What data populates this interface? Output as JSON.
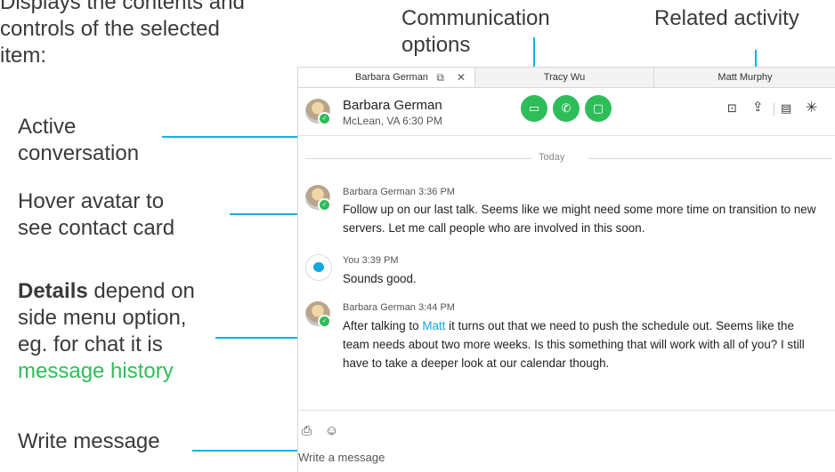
{
  "annotations": {
    "intro_line1": "Displays the contents and",
    "intro_line2": "controls of the selected",
    "intro_line3": "item:",
    "active_line1": "Active",
    "active_line2": "conversation",
    "hover_line1": "Hover avatar to",
    "hover_line2": "see contact card",
    "details_bold": "Details",
    "details_line1_rest": " depend on",
    "details_line2": "side menu option,",
    "details_line3": "eg. for chat it is",
    "details_line4": "message history",
    "write": "Write message",
    "comm_line1": "Communication",
    "comm_line2": "options",
    "related": "Related activity"
  },
  "tabs": [
    {
      "label": "Barbara German"
    },
    {
      "label": "Tracy Wu"
    },
    {
      "label": "Matt Murphy"
    }
  ],
  "header": {
    "name": "Barbara German",
    "location": "McLean, VA 6:30 PM"
  },
  "divider_label": "Today",
  "messages": [
    {
      "meta": "Barbara German  3:36 PM",
      "line1": "Follow up on our last talk. Seems like we might need some more time on transition to new",
      "line2": "servers. Let me call people who are involved in this soon."
    },
    {
      "meta": "You  3:39 PM",
      "line1": "Sounds good."
    },
    {
      "meta": "Barbara German  3:44 PM",
      "pre": "After talking to ",
      "link": "Matt",
      "post": " it turns out that we need to push the schedule out. Seems like the",
      "line2": "team needs about two more weeks. Is this something that will work with all of you? I still",
      "line3": "have to take a deeper look at our calendar though."
    }
  ],
  "compose": {
    "placeholder": "Write a message"
  },
  "colors": {
    "accent": "#15b0e8",
    "green": "#2ebd59"
  },
  "icons": [
    "popout-icon",
    "close-icon",
    "video-icon",
    "phone-icon",
    "share-screen-icon",
    "meeting-icon",
    "upload-icon",
    "contact-card-icon",
    "more-icon",
    "attach-file-icon",
    "emoji-icon",
    "chat-bubble-icon"
  ]
}
